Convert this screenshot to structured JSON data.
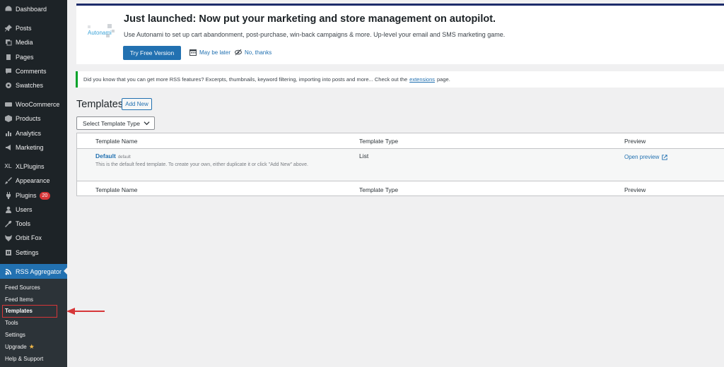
{
  "sidebar": {
    "items": [
      {
        "label": "Dashboard",
        "icon": "dashboard-icon"
      },
      {
        "label": "Posts",
        "icon": "pin-icon"
      },
      {
        "label": "Media",
        "icon": "media-icon"
      },
      {
        "label": "Pages",
        "icon": "page-icon"
      },
      {
        "label": "Comments",
        "icon": "comment-icon"
      },
      {
        "label": "Swatches",
        "icon": "gear-icon"
      },
      {
        "label": "WooCommerce",
        "icon": "woocommerce-icon"
      },
      {
        "label": "Products",
        "icon": "box-icon"
      },
      {
        "label": "Analytics",
        "icon": "bar-chart-icon"
      },
      {
        "label": "Marketing",
        "icon": "megaphone-icon"
      },
      {
        "label": "XLPlugins",
        "icon": "xl-icon"
      },
      {
        "label": "Appearance",
        "icon": "brush-icon"
      },
      {
        "label": "Plugins",
        "icon": "plug-icon",
        "badge": "20"
      },
      {
        "label": "Users",
        "icon": "user-icon"
      },
      {
        "label": "Tools",
        "icon": "wrench-icon"
      },
      {
        "label": "Orbit Fox",
        "icon": "fox-icon"
      },
      {
        "label": "Settings",
        "icon": "settings-icon"
      }
    ],
    "active": {
      "label": "RSS Aggregator",
      "icon": "rss-icon"
    },
    "submenu": [
      {
        "label": "Feed Sources"
      },
      {
        "label": "Feed Items"
      },
      {
        "label": "Templates"
      },
      {
        "label": "Tools"
      },
      {
        "label": "Settings"
      },
      {
        "label": "Upgrade",
        "icon": "star-icon"
      },
      {
        "label": "Help & Support"
      }
    ]
  },
  "notice": {
    "logo_text": "Autonami",
    "title": "Just launched: Now put your marketing and store management on autopilot.",
    "description": "Use Autonami to set up cart abandonment, post-purchase, win-back campaigns & more. Up-level your email and SMS marketing game.",
    "primary_button": "Try Free Version",
    "maybe_later": "May be later",
    "no_thanks": "No, thanks"
  },
  "info_notice": {
    "text_before": "Did you know that you can get more RSS features? Excerpts, thumbnails, keyword filtering, importing into posts and more... Check out the",
    "link": "extensions",
    "text_after": "page."
  },
  "page": {
    "title": "Templates",
    "add_new": "Add New",
    "select_placeholder": "Select Template Type"
  },
  "table": {
    "columns": [
      "Template Name",
      "Template Type",
      "Preview"
    ],
    "rows": [
      {
        "name": "Default",
        "name_sub": "default",
        "description": "This is the default feed template. To create your own, either duplicate it or click \"Add New\" above.",
        "type": "List",
        "preview": "Open preview"
      }
    ]
  },
  "colors": {
    "sidebar_bg": "#1d2327",
    "active_bg": "#2271b1",
    "link": "#2271b1",
    "highlight": "#d63638"
  }
}
